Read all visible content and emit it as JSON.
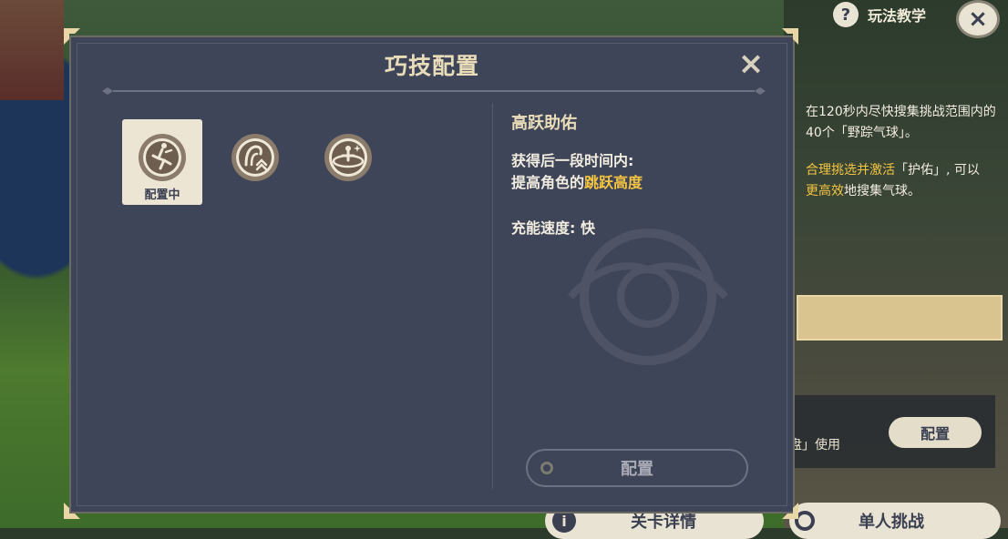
{
  "hud": {
    "help_label": "玩法教学",
    "help_icon": "?",
    "close_icon": "×"
  },
  "side": {
    "desc1": "在120秒内尽快搜集挑战范围内的40个「野踪气球」。",
    "desc2_pre": "合理挑选并激活",
    "desc2_hl": "「护佑」",
    "desc2_post": ", 可以",
    "desc3_hl": "更高效",
    "desc3_post": "地搜集气球。",
    "use_text": "盘」使用",
    "config_button": "配置",
    "stage_details": "关卡详情",
    "solo_challenge": "单人挑战"
  },
  "dialog": {
    "title": "巧技配置",
    "close_icon": "×",
    "skills": [
      {
        "name": "jump-skill",
        "label": "配置中",
        "selected": true
      },
      {
        "name": "wind-skill",
        "label": "",
        "selected": false
      },
      {
        "name": "ring-skill",
        "label": "",
        "selected": false
      }
    ],
    "detail": {
      "name": "高跃助佑",
      "line1": "获得后一段时间内:",
      "line2_pre": "提高角色的",
      "line2_hl": "跳跃高度",
      "speed": "充能速度: 快"
    },
    "config_button": "配置"
  },
  "colors": {
    "panel": "#3f4558",
    "gold": "#e9dcb8",
    "highlight": "#f5c542",
    "cream": "#ece5d4"
  }
}
